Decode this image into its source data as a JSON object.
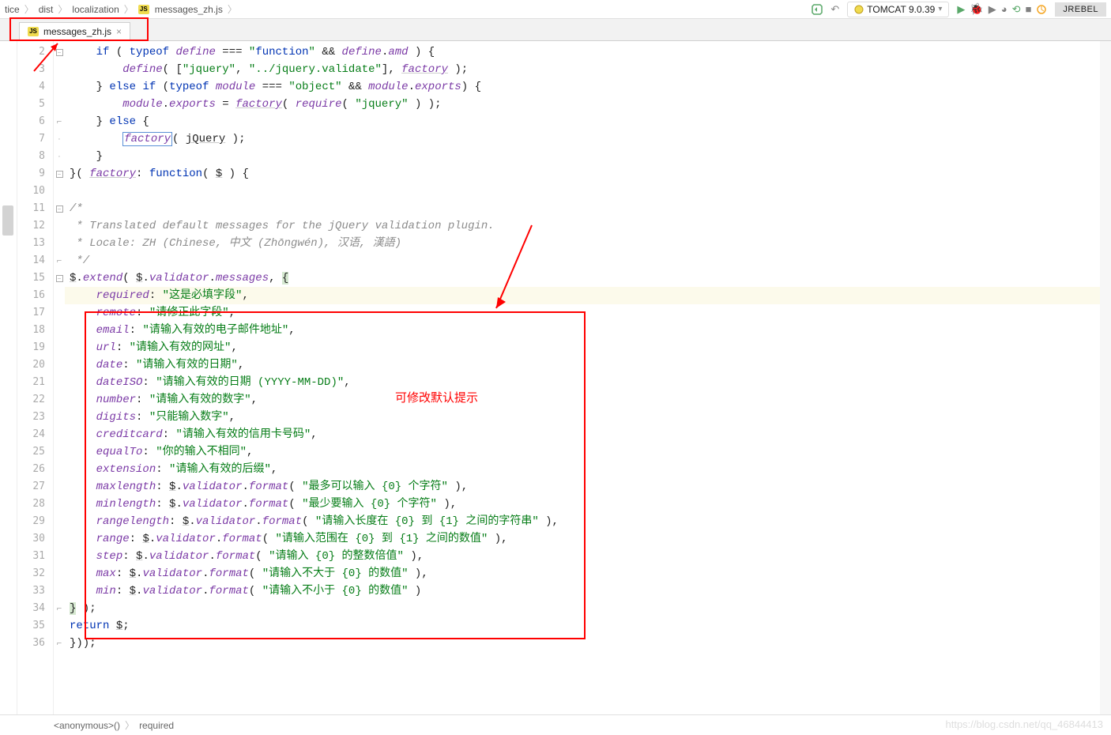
{
  "breadcrumb": {
    "seg1": "tice",
    "seg2": "dist",
    "seg3": "localization",
    "seg4": "messages_zh.js"
  },
  "run_config": "TOMCAT 9.0.39",
  "jrebel_label": "JREBEL",
  "tab": {
    "label": "messages_zh.js"
  },
  "annotations": {
    "hint_text": "可修改默认提示"
  },
  "code": {
    "l2": "    if ( typeof define === \"function\" && define.amd ) {",
    "l3": "        define( [\"jquery\", \"../jquery.validate\"], factory );",
    "l4": "    } else if (typeof module === \"object\" && module.exports) {",
    "l5": "        module.exports = factory( require( \"jquery\" ) );",
    "l6": "    } else {",
    "l7": "        factory( jQuery );",
    "l8": "    }",
    "l9": "}( factory: function( $ ) {",
    "l10": "",
    "l11": "/*",
    "l12": " * Translated default messages for the jQuery validation plugin.",
    "l13": " * Locale: ZH (Chinese, 中文 (Zhōngwén), 汉语, 漢語)",
    "l14": " */",
    "l15": "$.extend( $.validator.messages, {",
    "l16": "    required: \"这是必填字段\",",
    "l17": "    remote: \"请修正此字段\",",
    "l18": "    email: \"请输入有效的电子邮件地址\",",
    "l19": "    url: \"请输入有效的网址\",",
    "l20": "    date: \"请输入有效的日期\",",
    "l21": "    dateISO: \"请输入有效的日期 (YYYY-MM-DD)\",",
    "l22": "    number: \"请输入有效的数字\",",
    "l23": "    digits: \"只能输入数字\",",
    "l24": "    creditcard: \"请输入有效的信用卡号码\",",
    "l25": "    equalTo: \"你的输入不相同\",",
    "l26": "    extension: \"请输入有效的后缀\",",
    "l27": "    maxlength: $.validator.format( \"最多可以输入 {0} 个字符\" ),",
    "l28": "    minlength: $.validator.format( \"最少要输入 {0} 个字符\" ),",
    "l29": "    rangelength: $.validator.format( \"请输入长度在 {0} 到 {1} 之间的字符串\" ),",
    "l30": "    range: $.validator.format( \"请输入范围在 {0} 到 {1} 之间的数值\" ),",
    "l31": "    step: $.validator.format( \"请输入 {0} 的整数倍值\" ),",
    "l32": "    max: $.validator.format( \"请输入不大于 {0} 的数值\" ),",
    "l33": "    min: $.validator.format( \"请输入不小于 {0} 的数值\" )",
    "l34": "} );",
    "l35": "return $;",
    "l36": "}));"
  },
  "line_numbers": [
    "2",
    "3",
    "4",
    "5",
    "6",
    "7",
    "8",
    "9",
    "10",
    "11",
    "12",
    "13",
    "14",
    "15",
    "16",
    "17",
    "18",
    "19",
    "20",
    "21",
    "22",
    "23",
    "24",
    "25",
    "26",
    "27",
    "28",
    "29",
    "30",
    "31",
    "32",
    "33",
    "34",
    "35",
    "36"
  ],
  "status_nav": {
    "seg1": "<anonymous>()",
    "seg2": "required"
  },
  "watermark": "https://blog.csdn.net/qq_46844413"
}
